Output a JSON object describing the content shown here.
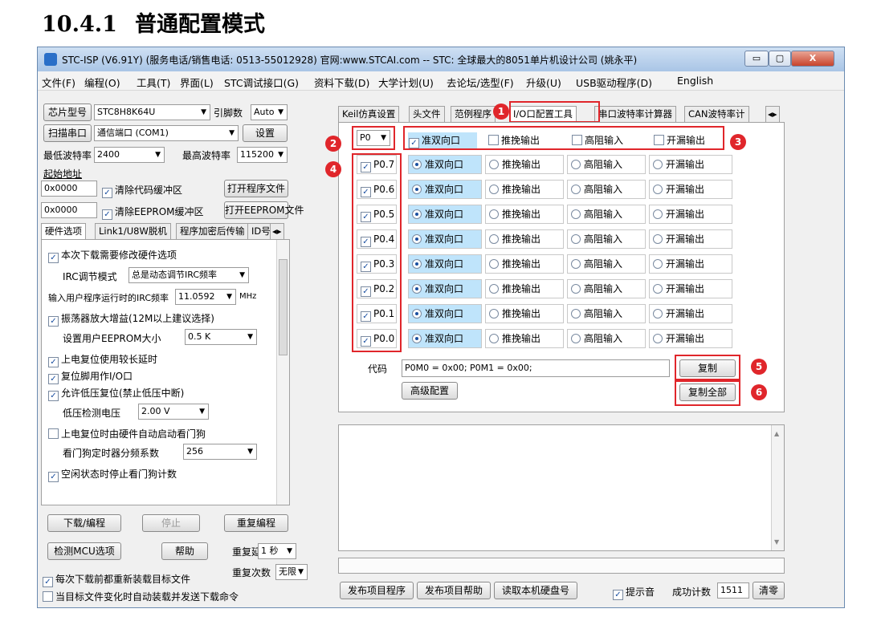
{
  "heading": {
    "number": "10.4.1",
    "title": "普通配置模式"
  },
  "window": {
    "title": "STC-ISP (V6.91Y) (服务电话/销售电话: 0513-55012928) 官网:www.STCAI.com  -- STC: 全球最大的8051单片机设计公司 (姚永平)",
    "buttons": {
      "minimize": "▭",
      "maximize": "▢",
      "close": "X"
    }
  },
  "menu": [
    "文件(F)",
    "编程(O)",
    "工具(T)",
    "界面(L)",
    "STC调试接口(G)",
    "资料下载(D)",
    "大学计划(U)",
    "去论坛/选型(F)",
    "升级(U)",
    "USB驱动程序(D)",
    "English"
  ],
  "left": {
    "chip_label": "芯片型号",
    "chip_value": "STC8H8K64U",
    "pin_label": "引脚数",
    "pin_value": "Auto",
    "scan_label": "扫描串口",
    "port_value": "通信端口 (COM1)",
    "settings_label": "设置",
    "min_baud_label": "最低波特率",
    "min_baud_value": "2400",
    "max_baud_label": "最高波特率",
    "max_baud_value": "115200",
    "start_addr_label": "起始地址",
    "addr1": "0x0000",
    "clear_code": "清除代码缓冲区",
    "open_program": "打开程序文件",
    "addr2": "0x0000",
    "clear_eeprom": "清除EEPROM缓冲区",
    "open_eeprom": "打开EEPROM文件",
    "tabs": [
      "硬件选项",
      "Link1/U8W脱机",
      "程序加密后传输",
      "ID号"
    ],
    "options": {
      "modify_hw": "本次下载需要修改硬件选项",
      "irc_mode_label": "IRC调节模式",
      "irc_mode_value": "总是动态调节IRC频率",
      "irc_freq_label": "输入用户程序运行时的IRC频率",
      "irc_freq_value": "11.0592",
      "irc_freq_unit": "MHz",
      "osc_gain": "振荡器放大增益(12M以上建议选择)",
      "eeprom_size_label": "设置用户EEPROM大小",
      "eeprom_size_value": "0.5 K",
      "long_reset": "上电复位使用较长延时",
      "reset_io": "复位脚用作I/O口",
      "lvd_reset": "允许低压复位(禁止低压中断)",
      "lvd_label": "低压检测电压",
      "lvd_value": "2.00 V",
      "wdt_auto": "上电复位时由硬件自动启动看门狗",
      "wdt_div_label": "看门狗定时器分频系数",
      "wdt_div_value": "256",
      "idle_wdt": "空闲状态时停止看门狗计数"
    },
    "download_btn": "下载/编程",
    "stop_btn": "停止",
    "reprogram_btn": "重复编程",
    "detect_btn": "检测MCU选项",
    "help_btn": "帮助",
    "retry_delay_label": "重复延时",
    "retry_delay_value": "1 秒",
    "retry_count_label": "重复次数",
    "retry_count_value": "无限",
    "reload_each": "每次下载前都重新装载目标文件",
    "auto_send": "当目标文件变化时自动装载并发送下载命令"
  },
  "right": {
    "tabs": [
      "Keil仿真设置",
      "头文件",
      "范例程序",
      "I/O口配置工具",
      "串口波特率计算器",
      "CAN波特率计"
    ],
    "port_value": "P0",
    "header_options": [
      "准双向口",
      "推挽输出",
      "高阻输入",
      "开漏输出"
    ],
    "pins": [
      "P0.7",
      "P0.6",
      "P0.5",
      "P0.4",
      "P0.3",
      "P0.2",
      "P0.1",
      "P0.0"
    ],
    "modes": [
      "准双向口",
      "推挽输出",
      "高阻输入",
      "开漏输出"
    ],
    "code_label": "代码",
    "code_value": "P0M0 = 0x00; P0M1 = 0x00;",
    "copy_btn": "复制",
    "advanced_btn": "高级配置",
    "copy_all_btn": "复制全部",
    "badges": [
      "1",
      "2",
      "3",
      "4",
      "5",
      "6"
    ]
  },
  "bottom": {
    "publish_program": "发布项目程序",
    "publish_help": "发布项目帮助",
    "read_disk": "读取本机硬盘号",
    "beep_label": "提示音",
    "success_label": "成功计数",
    "success_value": "1511",
    "clear_btn": "清零"
  },
  "colors": {
    "accent_red": "#e0262b",
    "selected_cell": "#bfe4fb"
  }
}
